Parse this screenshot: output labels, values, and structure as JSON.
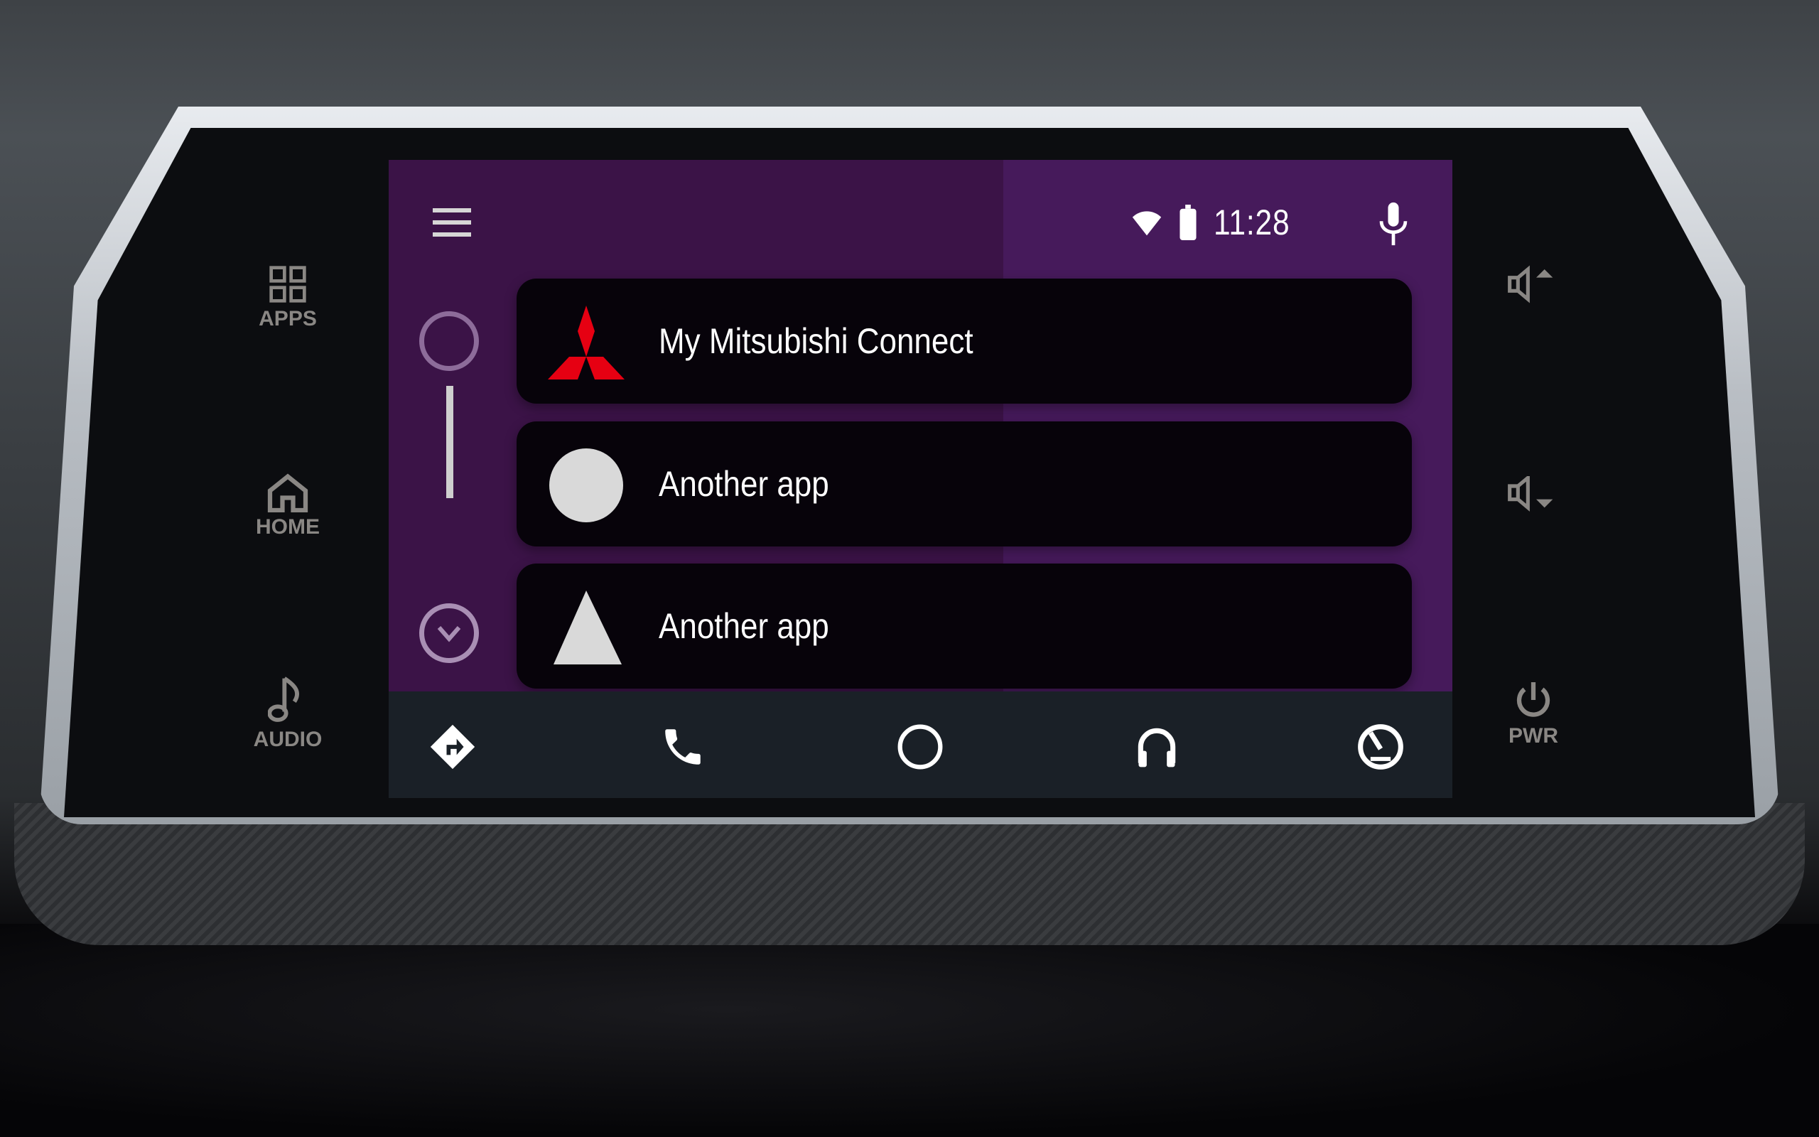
{
  "hardware": {
    "left_buttons": [
      {
        "label": "APPS",
        "icon": "apps-grid-icon"
      },
      {
        "label": "HOME",
        "icon": "home-icon"
      },
      {
        "label": "AUDIO",
        "icon": "music-note-icon"
      }
    ],
    "right_buttons": [
      {
        "label": "",
        "icon": "volume-up-icon"
      },
      {
        "label": "",
        "icon": "volume-down-icon"
      },
      {
        "label": "PWR",
        "icon": "power-icon"
      }
    ]
  },
  "topbar": {
    "menu_icon": "hamburger-menu-icon",
    "status": {
      "wifi_icon": "wifi-icon",
      "battery_icon": "battery-icon",
      "time": "11:28"
    },
    "mic_icon": "microphone-icon"
  },
  "side_controls": {
    "scroll_up_icon": "circle-scroll-up-icon",
    "scroll_down_icon": "chevron-down-circle-icon"
  },
  "app_list": [
    {
      "label": "My Mitsubishi Connect",
      "icon": "mitsubishi-logo-icon"
    },
    {
      "label": "Another app",
      "icon": "circle-icon"
    },
    {
      "label": "Another app",
      "icon": "triangle-icon"
    }
  ],
  "navbar": {
    "items": [
      {
        "name": "navigation",
        "icon": "directions-icon"
      },
      {
        "name": "phone",
        "icon": "phone-icon"
      },
      {
        "name": "home",
        "icon": "home-circle-icon"
      },
      {
        "name": "audio",
        "icon": "headphones-icon"
      },
      {
        "name": "overview",
        "icon": "dashboard-gauge-icon"
      }
    ]
  },
  "colors": {
    "screen_purple_dark": "#3b1347",
    "screen_purple_light": "#461a5b",
    "card_bg": "#07030a",
    "navbar_bg": "#1a2027",
    "mitsubishi_red": "#e60012"
  }
}
